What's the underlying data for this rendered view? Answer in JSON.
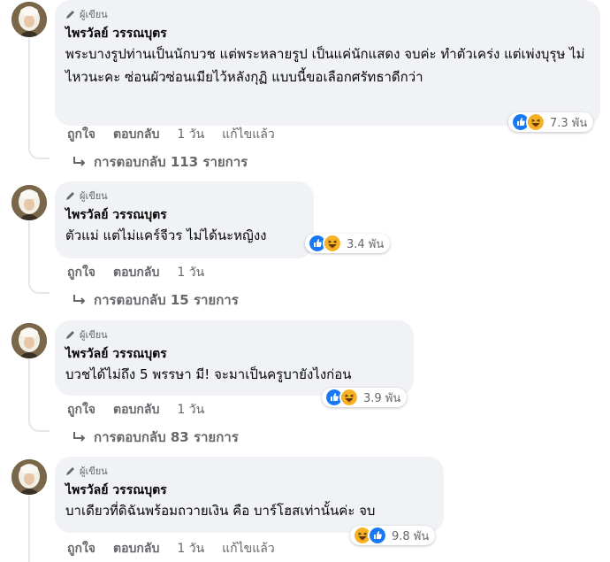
{
  "badge_label": "ผู้เขียน",
  "colors": {
    "like_blue": "#1877f2",
    "haha_yellow": "#f7b125",
    "secondary_text": "#65676b",
    "bubble_bg": "#f0f2f5"
  },
  "comments": [
    {
      "author": "ไพรวัลย์ วรรณบุตร",
      "text": "พระบางรูปท่านเป็นนักบวช แต่พระหลายรูป เป็นแค่นักแสดง จบค่ะ ทำตัวเคร่ง แต่เพ่งบุรุษ ไม่ไหวนะคะ ซ่อนผัวซ่อนเมียไว้หลังกุฏิ แบบนี้ขอเลือกศรัทธาดีกว่า",
      "reaction_count": "7.3 พัน",
      "reactions": [
        "like-icon",
        "haha-icon"
      ],
      "like_label": "ถูกใจ",
      "reply_label": "ตอบกลับ",
      "time": "1 วัน",
      "edited": "แก้ไขแล้ว",
      "replies_label": "การตอบกลับ 113 รายการ"
    },
    {
      "author": "ไพรวัลย์ วรรณบุตร",
      "text": "ตัวแม่ แต่ไม่แคร์จีวร ไม่ได้นะหญิงง",
      "reaction_count": "3.4 พัน",
      "reactions": [
        "like-icon",
        "haha-icon"
      ],
      "like_label": "ถูกใจ",
      "reply_label": "ตอบกลับ",
      "time": "1 วัน",
      "replies_label": "การตอบกลับ 15 รายการ"
    },
    {
      "author": "ไพรวัลย์ วรรณบุตร",
      "text": "บวชได้ไม่ถึง 5 พรรษา มี! จะมาเป็นครูบายังไงก่อน",
      "reaction_count": "3.9 พัน",
      "reactions": [
        "like-icon",
        "haha-icon"
      ],
      "like_label": "ถูกใจ",
      "reply_label": "ตอบกลับ",
      "time": "1 วัน",
      "replies_label": "การตอบกลับ 83 รายการ"
    },
    {
      "author": "ไพรวัลย์ วรรณบุตร",
      "text": "บาเดียวที่ดิฉันพร้อมถวายเงิน คือ บาร์โฮสเท่านั้นค่ะ จบ",
      "reaction_count": "9.8 พัน",
      "reactions": [
        "haha-icon",
        "like-icon"
      ],
      "like_label": "ถูกใจ",
      "reply_label": "ตอบกลับ",
      "time": "1 วัน",
      "edited": "แก้ไขแล้ว"
    }
  ]
}
